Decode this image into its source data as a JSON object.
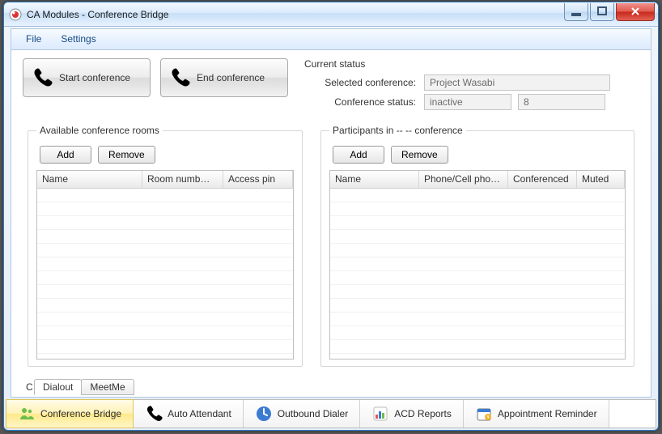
{
  "window": {
    "title": "CA Modules - Conference Bridge"
  },
  "menu": {
    "file": "File",
    "settings": "Settings"
  },
  "toolbar": {
    "start_label": "Start conference",
    "end_label": "End conference"
  },
  "status": {
    "title": "Current status",
    "selected_label": "Selected conference:",
    "selected_value": "Project Wasabi",
    "status_label": "Conference status:",
    "status_value": "inactive",
    "capacity_value": "8"
  },
  "rooms": {
    "legend": "Available conference rooms",
    "add": "Add",
    "remove": "Remove",
    "columns": {
      "name": "Name",
      "room": "Room numb…",
      "pin": "Access pin"
    },
    "rows": []
  },
  "participants": {
    "legend": "Participants in -- -- conference",
    "add": "Add",
    "remove": "Remove",
    "columns": {
      "name": "Name",
      "phone": "Phone/Cell pho…",
      "conf": "Conferenced",
      "muted": "Muted"
    },
    "rows": []
  },
  "inner_tabs": {
    "prefix": "C",
    "dialout": "Dialout",
    "meetme": "MeetMe"
  },
  "modules": {
    "conf": "Conference Bridge",
    "auto": "Auto Attendant",
    "dialer": "Outbound Dialer",
    "acd": "ACD Reports",
    "appt": "Appointment Reminder"
  }
}
